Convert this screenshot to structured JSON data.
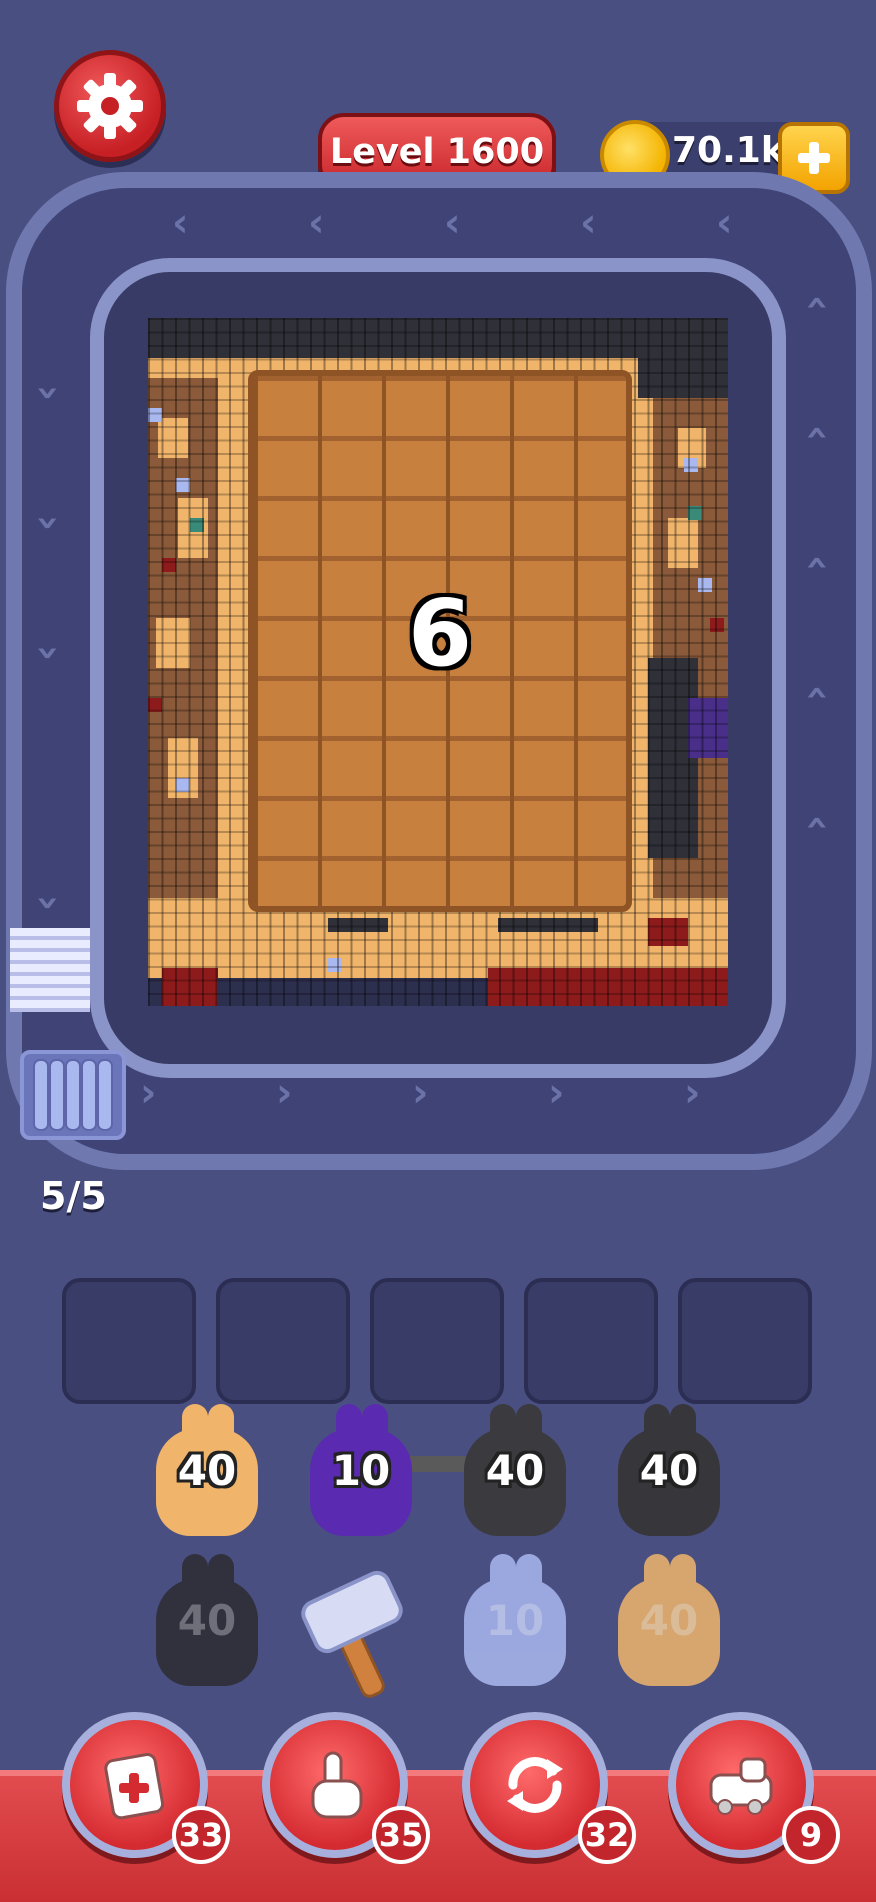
{
  "hud": {
    "level_label": "Level 1600",
    "coins": "70.1k"
  },
  "board": {
    "crate_number": "6"
  },
  "conveyor": {
    "capacity": "5/5"
  },
  "bunnies": [
    {
      "count": "40",
      "color": "#f0b56b",
      "dim": false
    },
    {
      "count": "10",
      "color": "#5a2bb0",
      "dim": false
    },
    {
      "count": "40",
      "color": "#3a3a3f",
      "dim": false
    },
    {
      "count": "40",
      "color": "#36363b",
      "dim": false
    },
    {
      "count": "40",
      "color": "#2c2c31",
      "dim": true
    },
    {
      "count": "10",
      "color": "#a9b8f0",
      "dim": true
    },
    {
      "count": "40",
      "color": "#f0b56b",
      "dim": true
    }
  ],
  "boosters": [
    {
      "icon": "add-card-icon",
      "count": "33"
    },
    {
      "icon": "tap-hand-icon",
      "count": "35"
    },
    {
      "icon": "shuffle-icon",
      "count": "32"
    },
    {
      "icon": "train-icon",
      "count": "9"
    }
  ],
  "colors": {
    "background": "#4a4f82",
    "accent_red": "#d42b31",
    "coin_gold": "#f4b400"
  }
}
